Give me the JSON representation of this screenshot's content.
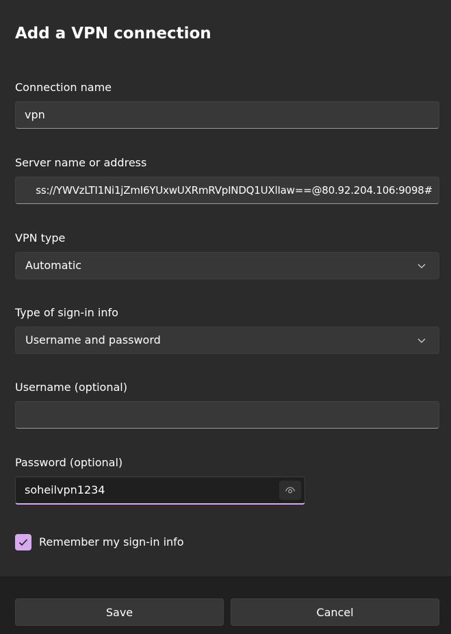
{
  "dialog": {
    "title": "Add a VPN connection"
  },
  "connection_name": {
    "label": "Connection name",
    "value": "vpn"
  },
  "server": {
    "label": "Server name or address",
    "value": "ss://YWVzLTI1Ni1jZmI6YUxwUXRmRVpINDQ1UXlIaw==@80.92.204.106:9098#"
  },
  "vpn_type": {
    "label": "VPN type",
    "selected": "Automatic"
  },
  "signin_type": {
    "label": "Type of sign-in info",
    "selected": "Username and password"
  },
  "username": {
    "label": "Username (optional)",
    "value": ""
  },
  "password": {
    "label": "Password (optional)",
    "value": "soheilvpn1234"
  },
  "remember": {
    "label": "Remember my sign-in info",
    "checked": true
  },
  "footer": {
    "save_label": "Save",
    "cancel_label": "Cancel"
  },
  "colors": {
    "accent": "#d9a9f0",
    "background": "#2b2b2b",
    "footer_background": "#202020",
    "field_background": "#383838"
  },
  "icons": {
    "dropdown": "chevron-down-icon",
    "reveal": "eye-icon",
    "checkmark": "checkmark-icon"
  }
}
